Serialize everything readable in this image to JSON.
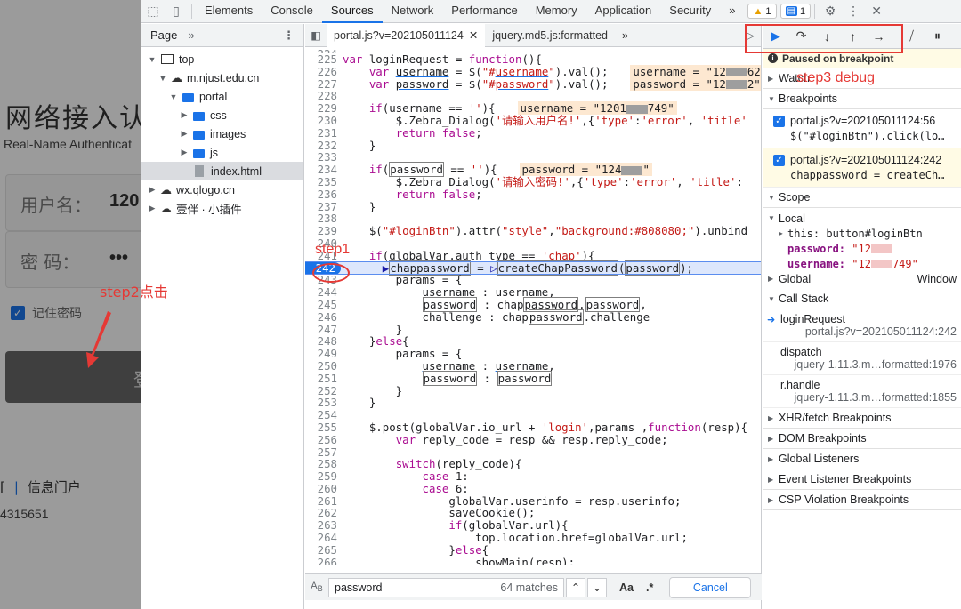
{
  "background_page": {
    "title": "网络接入认",
    "subtitle": "Real-Name Authenticat",
    "username_label": "用户名：",
    "username_value": "120",
    "password_label": "密  码：",
    "password_value": "•••",
    "remember_label": "记住密码",
    "login_glyph": "登",
    "links_prefix": "[",
    "links_sep": "|",
    "portal_link": "信息门户",
    "phone": "4315651"
  },
  "annotations": {
    "step1": "step1",
    "step2": "step2点击",
    "step3": "step3 debug"
  },
  "toolbar": {
    "tabs": [
      "Elements",
      "Console",
      "Sources",
      "Network",
      "Performance",
      "Memory",
      "Application",
      "Security"
    ],
    "active_tab": "Sources",
    "more": "»",
    "warnings": "1",
    "messages": "1"
  },
  "navigator": {
    "tab": "Page",
    "more": "»",
    "tree": [
      {
        "label": "top",
        "depth": 0,
        "kind": "frame",
        "open": true
      },
      {
        "label": "m.njust.edu.cn",
        "depth": 1,
        "kind": "cloud",
        "open": true
      },
      {
        "label": "portal",
        "depth": 2,
        "kind": "folder",
        "open": true
      },
      {
        "label": "css",
        "depth": 3,
        "kind": "folder",
        "open": false
      },
      {
        "label": "images",
        "depth": 3,
        "kind": "folder",
        "open": false
      },
      {
        "label": "js",
        "depth": 3,
        "kind": "folder",
        "open": false
      },
      {
        "label": "index.html",
        "depth": 3,
        "kind": "file",
        "selected": true
      },
      {
        "label": "wx.qlogo.cn",
        "depth": 0,
        "kind": "cloud",
        "open": false
      },
      {
        "label": "壹伴 · 小插件",
        "depth": 0,
        "kind": "cloud",
        "open": false
      }
    ]
  },
  "editor": {
    "tabs": [
      {
        "label": "portal.js?v=202105011124",
        "active": true
      },
      {
        "label": "jquery.md5.js:formatted",
        "active": false
      }
    ],
    "more": "»"
  },
  "search": {
    "value": "password",
    "matches": "64 matches",
    "case_label": "Aa",
    "regex_label": ".*",
    "cancel": "Cancel"
  },
  "debugger": {
    "paused": "Paused on breakpoint",
    "watch": "Watch",
    "breakpoints_header": "Breakpoints",
    "breakpoints": [
      {
        "file": "portal.js?v=202105011124:56",
        "code": "$(\"#loginBtn\").click(lo…",
        "active": false
      },
      {
        "file": "portal.js?v=202105011124:242",
        "code": "chappassword = createCh…",
        "active": true
      }
    ],
    "scope_header": "Scope",
    "local_label": "Local",
    "this_label": "this: button#loginBtn",
    "password_key": "password:",
    "password_val": "\"12",
    "username_key": "username:",
    "username_val": "\"12",
    "username_val_tail": "749\"",
    "global_label": "Global",
    "global_value": "Window",
    "callstack_header": "Call Stack",
    "callstack": [
      {
        "fn": "loginRequest",
        "loc": "portal.js?v=202105011124:242",
        "current": true
      },
      {
        "fn": "dispatch",
        "loc": "jquery-1.11.3.m…formatted:1976",
        "current": false
      },
      {
        "fn": "r.handle",
        "loc": "jquery-1.11.3.m…formatted:1855",
        "current": false
      }
    ],
    "more_sections": [
      "XHR/fetch Breakpoints",
      "DOM Breakpoints",
      "Global Listeners",
      "Event Listener Breakpoints",
      "CSP Violation Breakpoints"
    ]
  }
}
